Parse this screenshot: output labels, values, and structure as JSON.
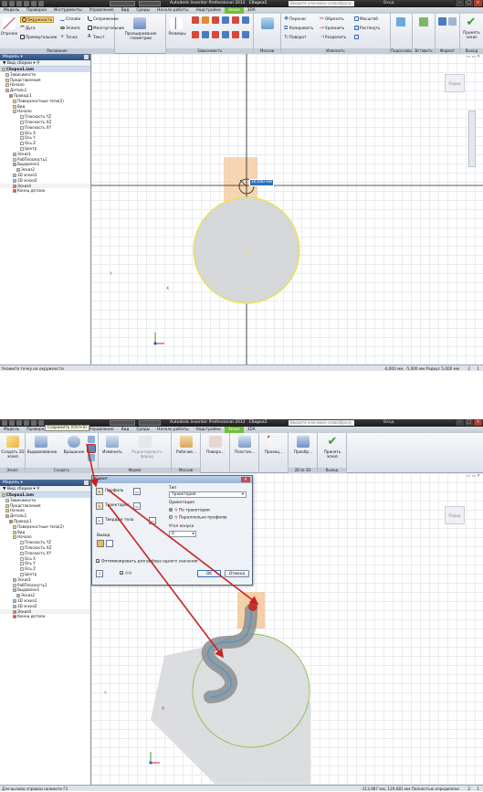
{
  "shot1": {
    "title": {
      "app": "Autodesk Inventor Professional 2012",
      "doc": "Сборка1",
      "search_placeholder": "Введите ключевое слово/фразу",
      "login": "Вход"
    },
    "tabs": [
      "Модель",
      "Проверка",
      "Инструменты",
      "Управление",
      "Вид",
      "Среды",
      "Начало работы",
      "Надстройки",
      "Эскиз",
      "3DA"
    ],
    "active_tab": "Эскиз",
    "ribbon": {
      "draw": {
        "otrezok": "Отрезок",
        "krug": "Окружность",
        "duga": "Дуга",
        "pryamougolnik": "Прямоугольник",
        "splain": "Сплайн",
        "ellips": "Эллипс",
        "tochka": "Точка",
        "sopryazhenie": "Сопряжение",
        "mnogougolnik": "Многоугольник",
        "tekst": "Текст",
        "label": "Рисование"
      },
      "project": {
        "proektirovanie": "Проецирование геометрии"
      },
      "sizes": {
        "razmery": "Размеры",
        "label": "Зависимость"
      },
      "modify": {
        "perenos": "Перенос",
        "kopirovat": "Копировать",
        "povorot": "Поворот",
        "obrezat": "Обрезать",
        "udlinit": "Удлинить",
        "razdelit": "Разделить",
        "masshtab": "Масштаб",
        "rastyanut": "Растянуть",
        "label": "Изменить"
      },
      "groups": {
        "massiv": "Массив",
        "podosnova": "Подоснова",
        "vstavit": "Вставить",
        "format": "Формат",
        "vyhod": "Выход"
      },
      "accept": "Принять эскиз"
    },
    "panel": {
      "title": "Модель",
      "toolbar": "Вид сборки"
    },
    "tree": [
      "Сборка1.iam",
      "Зависимости",
      "Представления",
      "Начало",
      "Деталь1",
      "Провод:1",
      "Поверхностные тела(2)",
      "Вид",
      "Начало",
      "Плоскость YZ",
      "Плоскость XZ",
      "Плоскость XY",
      "Ось X",
      "Ось Y",
      "Ось Z",
      "Центр",
      "Эскиз1",
      "РабПлоскость1",
      "Выдавлен1",
      "Эскиз2",
      "3D эскиз1",
      "3D эскиз2",
      "Эскиз4",
      "Конец детали"
    ],
    "dimension_value": "10,000 мм",
    "viewcube": "Перед",
    "axes": {
      "x": "X",
      "y": "Y"
    },
    "status": {
      "hint": "Укажите точку на окружности",
      "coords": "-0,000 мм, -5,000 мм Радиус 5,000 мм",
      "n1": "2",
      "n2": "1"
    }
  },
  "shot2": {
    "title": {
      "app": "Autodesk Inventor Professional 2012",
      "doc": "Сборка1",
      "search_placeholder": "Введите ключевое слово/фразу",
      "login": "Вход",
      "tooltip": "Сохранить (Ctrl+S)"
    },
    "tabs": [
      "Модель",
      "Проверка",
      "Инструменты",
      "Управление",
      "Вид",
      "Среды",
      "Начало работы",
      "Надстройки",
      "Эскиз",
      "3DA"
    ],
    "active_tab": "Эскиз",
    "ribbon": {
      "sozdat": "Создать 2D эскиз",
      "vydavlivanie": "Выдавливание",
      "vrashchenie": "Вращение",
      "izmenit": "Изменить",
      "redaktirovat": "Редактировать форму",
      "rabochie": "Рабочие...",
      "poverhnost": "Поверх...",
      "plastina": "Пластин...",
      "proekciya": "Проекц...",
      "preobr": "Преобр...",
      "prinyat": "Принять эскиз",
      "groups": {
        "eskiz": "Эскиз",
        "sozdat": "Создать",
        "forma": "Форма",
        "massiv": "Массив",
        "v2d": "2D to 3D",
        "vyhod": "Выход"
      }
    },
    "panel": {
      "title": "Модель",
      "toolbar": "Вид сборки"
    },
    "tree": [
      "Сборка1.iam",
      "Зависимости",
      "Представления",
      "Начало",
      "Деталь1",
      "Провод:1",
      "Поверхностные тела(2)",
      "Вид",
      "Начало",
      "Плоскость YZ",
      "Плоскость XZ",
      "Плоскость XY",
      "Ось X",
      "Ось Y",
      "Ось Z",
      "Центр",
      "Эскиз1",
      "РабПлоскость1",
      "Выдавлен1",
      "Эскиз2",
      "3D эскиз1",
      "3D эскиз2",
      "Эскиз4",
      "Конец детали"
    ],
    "dialog": {
      "title": "Сдвиг",
      "profil": "Профиль",
      "traektoriya": "Траектория",
      "tverdye": "Твердые тела",
      "tip_label": "Тип",
      "tip_value": "Траектория",
      "orient_label": "Ориентация",
      "po_traektorii": "По траектории",
      "parallelno": "Параллельно профилю",
      "ugol_label": "Угол конуса",
      "ugol_value": "0",
      "vyvod": "Вывод",
      "optimize": "Оптимизировать для выбора одного значения",
      "ok": "OK",
      "cancel": "Отмена"
    },
    "viewcube": "Перед",
    "axes": {
      "x": "X",
      "y": "Y"
    },
    "status": {
      "hint": "Для вызова справки нажмите F1",
      "coords": "-113,987 мм, 139,681 мм  Полностью определено",
      "n1": "2",
      "n2": "1"
    }
  },
  "colors": {
    "titlebar": "#2a2a2a",
    "active_tab": "#6fbf3a",
    "sketch_yellow": "#f2e23c",
    "arrow_red": "#c8231e",
    "highlight_orange": "#f3c89a",
    "path_blue": "#3a9bd6"
  }
}
